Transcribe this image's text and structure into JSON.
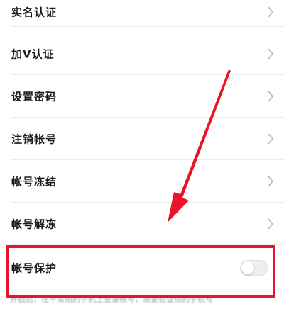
{
  "settings": {
    "items": [
      {
        "label": "实名认证"
      },
      {
        "label": "加V认证"
      },
      {
        "label": "设置密码"
      },
      {
        "label": "注销帐号"
      },
      {
        "label": "帐号冻结"
      },
      {
        "label": "帐号解冻"
      }
    ],
    "protection": {
      "label": "帐号保护",
      "enabled": false
    },
    "footnote": "开启后，在不常用的手机上登录帐号，需要验证你的手机号"
  },
  "icons": {
    "row_chevron": "chevron-right-icon",
    "annotation_arrow": "red-arrow-icon"
  },
  "colors": {
    "annotation": "#e8142a",
    "chevron": "#b5b5b5",
    "divider": "#ececec",
    "toggle_off": "#eeeeee"
  }
}
